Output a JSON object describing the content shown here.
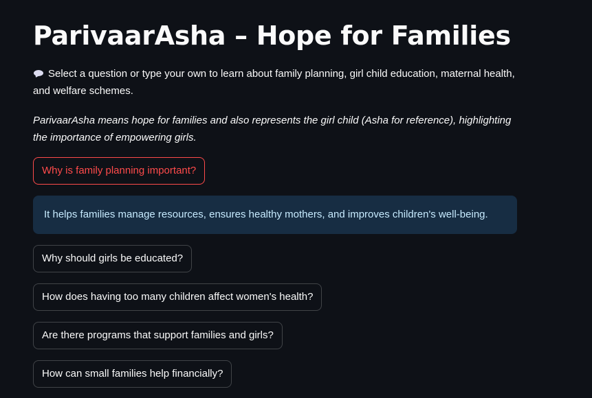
{
  "page": {
    "title": "ParivaarAsha – Hope for Families",
    "intro": "Select a question or type your own to learn about family planning, girl child education, maternal health, and welfare schemes.",
    "intro_icon": "speech-bubble-icon",
    "meaning": "ParivaarAsha means hope for families and also represents the girl child (Asha for reference), highlighting the importance of empowering girls."
  },
  "questions": [
    {
      "label": "Why is family planning important?",
      "selected": true
    },
    {
      "label": "Why should girls be educated?",
      "selected": false
    },
    {
      "label": "How does having too many children affect women's health?",
      "selected": false
    },
    {
      "label": "Are there programs that support families and girls?",
      "selected": false
    },
    {
      "label": "How can small families help financially?",
      "selected": false
    }
  ],
  "answer": {
    "text": "It helps families manage resources, ensures healthy mothers, and improves children's well-being."
  },
  "colors": {
    "background": "#0e1117",
    "accent": "#ff4b4b",
    "info_background": "#172d43",
    "info_text": "#c7ebff"
  }
}
